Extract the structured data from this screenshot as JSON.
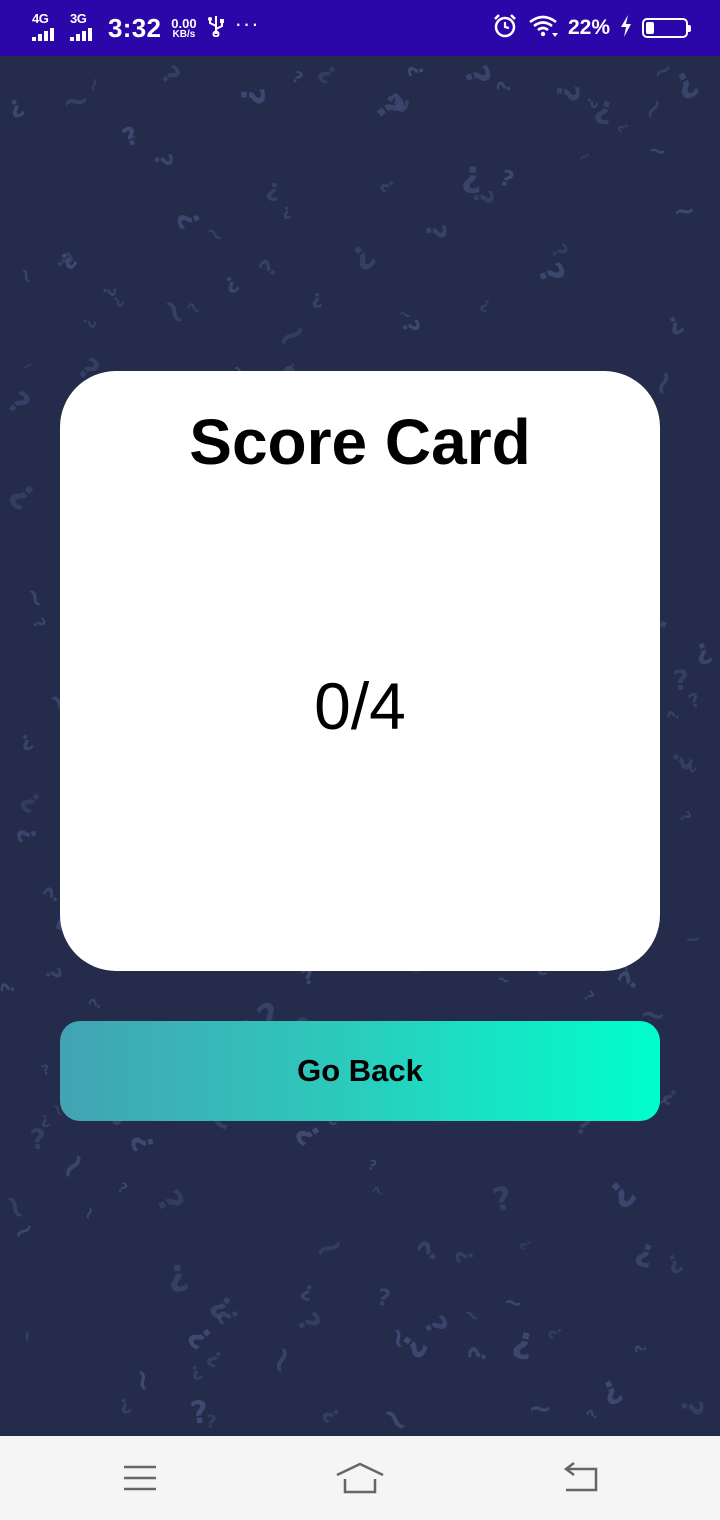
{
  "status_bar": {
    "network1": "4G",
    "network2": "3G",
    "time": "3:32",
    "speed_value": "0.00",
    "speed_unit": "KB/s",
    "battery_percent": "22%",
    "battery_level": 0.22,
    "icons": [
      "usb-icon",
      "more-icon",
      "alarm-icon",
      "wifi-icon",
      "charging-icon",
      "battery-icon"
    ]
  },
  "score_card": {
    "title": "Score Card",
    "score": "0/4"
  },
  "actions": {
    "go_back_label": "Go Back"
  },
  "nav_bar": {
    "icons": [
      "menu-icon",
      "home-icon",
      "back-icon"
    ]
  },
  "colors": {
    "status_bar_bg": "#2b06a8",
    "page_bg": "#252b4a",
    "button_gradient_start": "#43a3b3",
    "button_gradient_end": "#00ffcc",
    "card_bg": "#ffffff"
  }
}
